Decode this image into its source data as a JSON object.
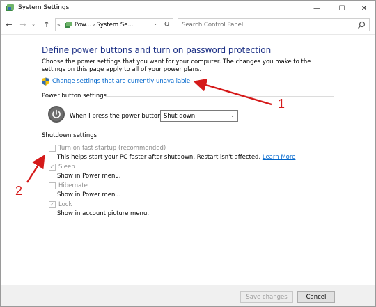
{
  "window": {
    "title": "System Settings",
    "controls": {
      "minimize": "—",
      "maximize": "☐",
      "close": "✕"
    }
  },
  "nav": {
    "back": "←",
    "forward": "→",
    "recent": "⌄",
    "up": "↑",
    "breadcrumb_sep_start": "«",
    "breadcrumbs": [
      "Pow...",
      "System Se..."
    ],
    "crumb_sep": "›",
    "dropdown": "⌄",
    "refresh": "↻",
    "search_placeholder": "Search Control Panel"
  },
  "main": {
    "title": "Define power buttons and turn on password protection",
    "description": "Choose the power settings that you want for your computer. The changes you make to the settings on this page apply to all of your power plans.",
    "change_link": "Change settings that are currently unavailable"
  },
  "power_section": {
    "heading": "Power button settings",
    "label": "When I press the power button:",
    "selected": "Shut down",
    "chevron": "⌄"
  },
  "shutdown_section": {
    "heading": "Shutdown settings",
    "items": [
      {
        "label": "Turn on fast startup (recommended)",
        "checked": false,
        "description": "This helps start your PC faster after shutdown. Restart isn't affected. ",
        "link": "Learn More"
      },
      {
        "label": "Sleep",
        "checked": true,
        "description": "Show in Power menu."
      },
      {
        "label": "Hibernate",
        "checked": false,
        "description": "Show in Power menu."
      },
      {
        "label": "Lock",
        "checked": true,
        "description": "Show in account picture menu."
      }
    ],
    "check_glyph": "✓"
  },
  "footer": {
    "save_label": "Save changes",
    "cancel_label": "Cancel"
  },
  "annotations": {
    "callout_1": "1",
    "callout_2": "2",
    "color": "#d51a1a"
  },
  "colors": {
    "title_blue": "#1e3287",
    "link_blue": "#0066cc"
  }
}
